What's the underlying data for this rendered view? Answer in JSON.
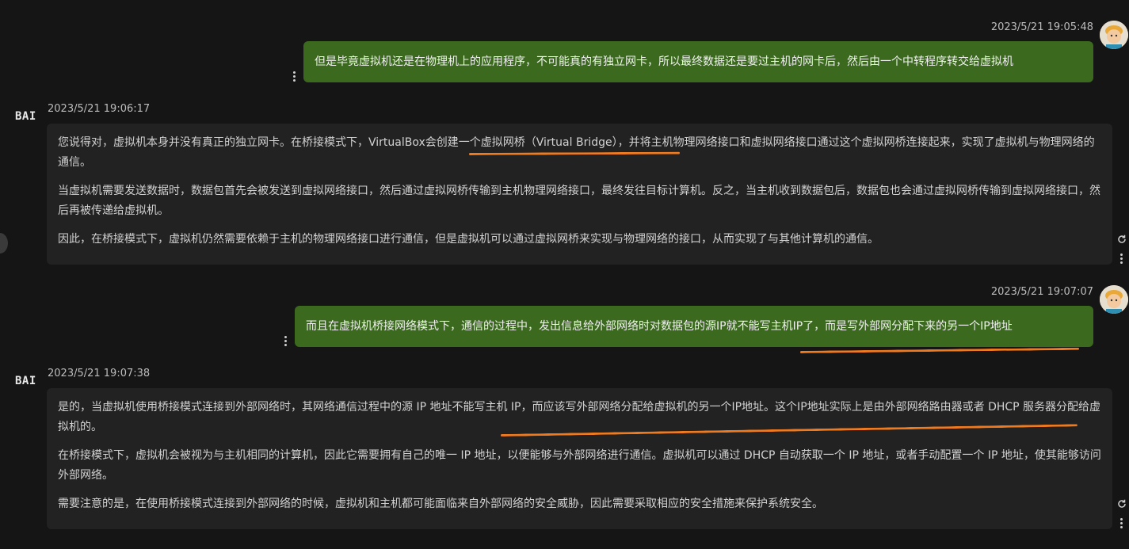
{
  "messages": [
    {
      "role": "user",
      "timestamp": "2023/5/21 19:05:48",
      "text": "但是毕竟虚拟机还是在物理机上的应用程序，不可能真的有独立网卡，所以最终数据还是要过主机的网卡后，然后由一个中转程序转交给虚拟机"
    },
    {
      "role": "bot",
      "logo": "BAI",
      "timestamp": "2023/5/21 19:06:17",
      "paragraphs": [
        "您说得对，虚拟机本身并没有真正的独立网卡。在桥接模式下，VirtualBox会创建一个虚拟网桥（Virtual Bridge），并将主机物理网络接口和虚拟网络接口通过这个虚拟网桥连接起来，实现了虚拟机与物理网络的通信。",
        "当虚拟机需要发送数据时，数据包首先会被发送到虚拟网络接口，然后通过虚拟网桥传输到主机物理网络接口，最终发往目标计算机。反之，当主机收到数据包后，数据包也会通过虚拟网桥传输到虚拟网络接口，然后再被传递给虚拟机。",
        "因此，在桥接模式下，虚拟机仍然需要依赖于主机的物理网络接口进行通信，但是虚拟机可以通过虚拟网桥来实现与物理网络的接口，从而实现了与其他计算机的通信。"
      ]
    },
    {
      "role": "user",
      "timestamp": "2023/5/21 19:07:07",
      "text": "而且在虚拟机桥接网络模式下，通信的过程中，发出信息给外部网络时对数据包的源IP就不能写主机IP了，而是写外部网分配下来的另一个IP地址"
    },
    {
      "role": "bot",
      "logo": "BAI",
      "timestamp": "2023/5/21 19:07:38",
      "paragraphs": [
        "是的，当虚拟机使用桥接模式连接到外部网络时，其网络通信过程中的源 IP 地址不能写主机 IP，而应该写外部网络分配给虚拟机的另一个IP地址。这个IP地址实际上是由外部网络路由器或者 DHCP 服务器分配给虚拟机的。",
        "在桥接模式下，虚拟机会被视为与主机相同的计算机，因此它需要拥有自己的唯一 IP 地址，以便能够与外部网络进行通信。虚拟机可以通过 DHCP 自动获取一个 IP 地址，或者手动配置一个 IP 地址，使其能够访问外部网络。",
        "需要注意的是，在使用桥接模式连接到外部网络的时候，虚拟机和主机都可能面临来自外部网络的安全威胁，因此需要采取相应的安全措施来保护系统安全。"
      ]
    }
  ],
  "colors": {
    "background": "#151515",
    "user_bubble": "#3b6a1e",
    "bot_bubble": "#222222",
    "annotation": "#f07a1f"
  },
  "icons": [
    "more-vertical-icon",
    "refresh-icon",
    "user-avatar-icon"
  ]
}
